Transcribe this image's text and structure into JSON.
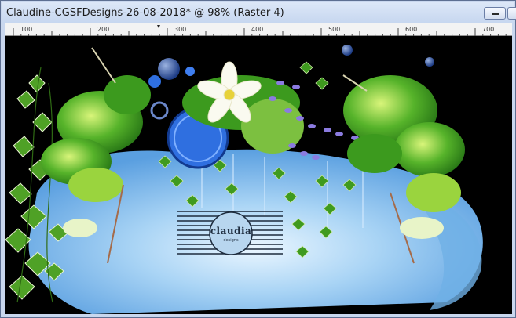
{
  "window": {
    "title": "Claudine-CGSFDesigns-26-08-2018* @  98% (Raster 4)"
  },
  "controls": {
    "minimize_icon": "minimize-icon",
    "maximize_icon": "maximize-icon"
  },
  "ruler": {
    "ticks": [
      "100",
      "200",
      "300",
      "400",
      "500",
      "600",
      "700"
    ]
  },
  "canvas": {
    "watermark": {
      "text": "claudia",
      "subtext": "designs"
    }
  },
  "colors": {
    "titlebar": "#d6e3f6",
    "background": "#000000",
    "water": "#8fc3ee",
    "leaf": "#3f9a1f",
    "flower_purple": "#7b6ad6",
    "accent_blue": "#2f6fe0"
  }
}
